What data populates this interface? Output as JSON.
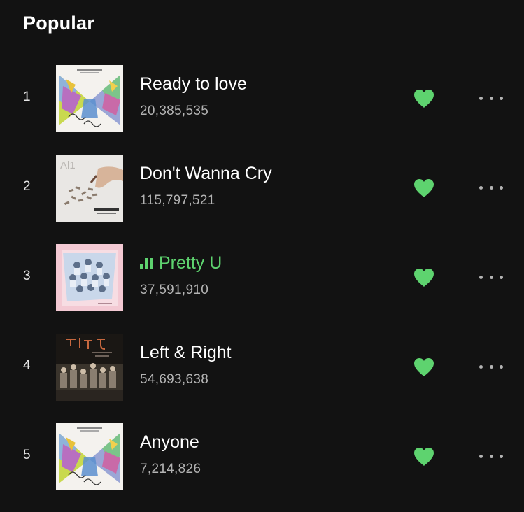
{
  "section": {
    "title": "Popular"
  },
  "colors": {
    "accent": "#5ed36f",
    "background": "#121212",
    "secondary_text": "#b3b3b3"
  },
  "tracks": [
    {
      "index": "1",
      "title": "Ready to love",
      "plays": "20,385,535",
      "liked": true,
      "playing": false,
      "cover": "your-choice-album-cover"
    },
    {
      "index": "2",
      "title": "Don't Wanna Cry",
      "plays": "115,797,521",
      "liked": true,
      "playing": false,
      "cover": "al1-album-cover"
    },
    {
      "index": "3",
      "title": "Pretty U",
      "plays": "37,591,910",
      "liked": true,
      "playing": true,
      "cover": "love-and-letter-album-cover"
    },
    {
      "index": "4",
      "title": "Left & Right",
      "plays": "54,693,638",
      "liked": true,
      "playing": false,
      "cover": "henggarae-album-cover"
    },
    {
      "index": "5",
      "title": "Anyone",
      "plays": "7,214,826",
      "liked": true,
      "playing": false,
      "cover": "your-choice-album-cover"
    }
  ]
}
